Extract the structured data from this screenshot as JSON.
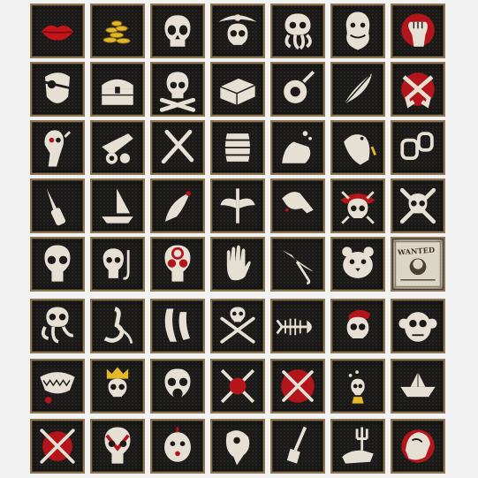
{
  "sheet": {
    "columns": 7,
    "rows": 8,
    "colors": {
      "tile_bg": "#1b1a18",
      "frame_gold": "#8c7550",
      "icon_cloth": "#e6e0d4",
      "accent_red": "#b3151a",
      "accent_gold": "#e4b928"
    }
  },
  "icons": [
    {
      "name": "lips-icon"
    },
    {
      "name": "gold-coins-icon"
    },
    {
      "name": "skull-icon"
    },
    {
      "name": "pirate-captain-skull-icon"
    },
    {
      "name": "kraken-skull-icon"
    },
    {
      "name": "bearded-pirate-face-icon"
    },
    {
      "name": "raised-fist-icon"
    },
    {
      "name": "eyepatch-pirate-icon"
    },
    {
      "name": "treasure-chest-icon"
    },
    {
      "name": "skull-crossbones-icon"
    },
    {
      "name": "closed-book-icon"
    },
    {
      "name": "cursed-amulet-icon"
    },
    {
      "name": "feather-quill-icon"
    },
    {
      "name": "crossed-pistols-icon"
    },
    {
      "name": "plague-skull-icon"
    },
    {
      "name": "cannon-icon"
    },
    {
      "name": "crossed-daggers-icon"
    },
    {
      "name": "rum-barrel-icon"
    },
    {
      "name": "splash-hand-icon"
    },
    {
      "name": "parrot-icon"
    },
    {
      "name": "shackles-icon"
    },
    {
      "name": "knife-icon"
    },
    {
      "name": "sailboat-icon"
    },
    {
      "name": "claw-icon"
    },
    {
      "name": "winged-sword-icon"
    },
    {
      "name": "ghost-hand-icon"
    },
    {
      "name": "red-bandana-skull-icon"
    },
    {
      "name": "skull-bones-icon"
    },
    {
      "name": "dripping-skull-icon"
    },
    {
      "name": "skull-hook-icon"
    },
    {
      "name": "bloody-skull-icon"
    },
    {
      "name": "open-hand-icon"
    },
    {
      "name": "broken-umbrella-icon"
    },
    {
      "name": "tiger-head-icon"
    },
    {
      "name": "wanted-poster-icon",
      "text": "WANTED"
    },
    {
      "name": "skull-tentacles-icon"
    },
    {
      "name": "sea-serpent-icon"
    },
    {
      "name": "ghost-sails-icon"
    },
    {
      "name": "skull-crossed-swords-icon"
    },
    {
      "name": "fish-skeleton-icon"
    },
    {
      "name": "red-cap-skull-icon"
    },
    {
      "name": "monkey-skull-icon"
    },
    {
      "name": "shark-jaw-icon"
    },
    {
      "name": "crowned-skull-icon"
    },
    {
      "name": "gas-mask-icon"
    },
    {
      "name": "bloody-tools-icon"
    },
    {
      "name": "crossed-swords-red-icon"
    },
    {
      "name": "potion-skull-icon"
    },
    {
      "name": "paper-boat-icon"
    },
    {
      "name": "crossed-blades-red-icon"
    },
    {
      "name": "red-painted-skull-icon"
    },
    {
      "name": "shrunken-head-icon"
    },
    {
      "name": "bird-skull-icon"
    },
    {
      "name": "shovel-icon"
    },
    {
      "name": "trident-hand-icon"
    },
    {
      "name": "grabbing-hand-icon"
    }
  ]
}
